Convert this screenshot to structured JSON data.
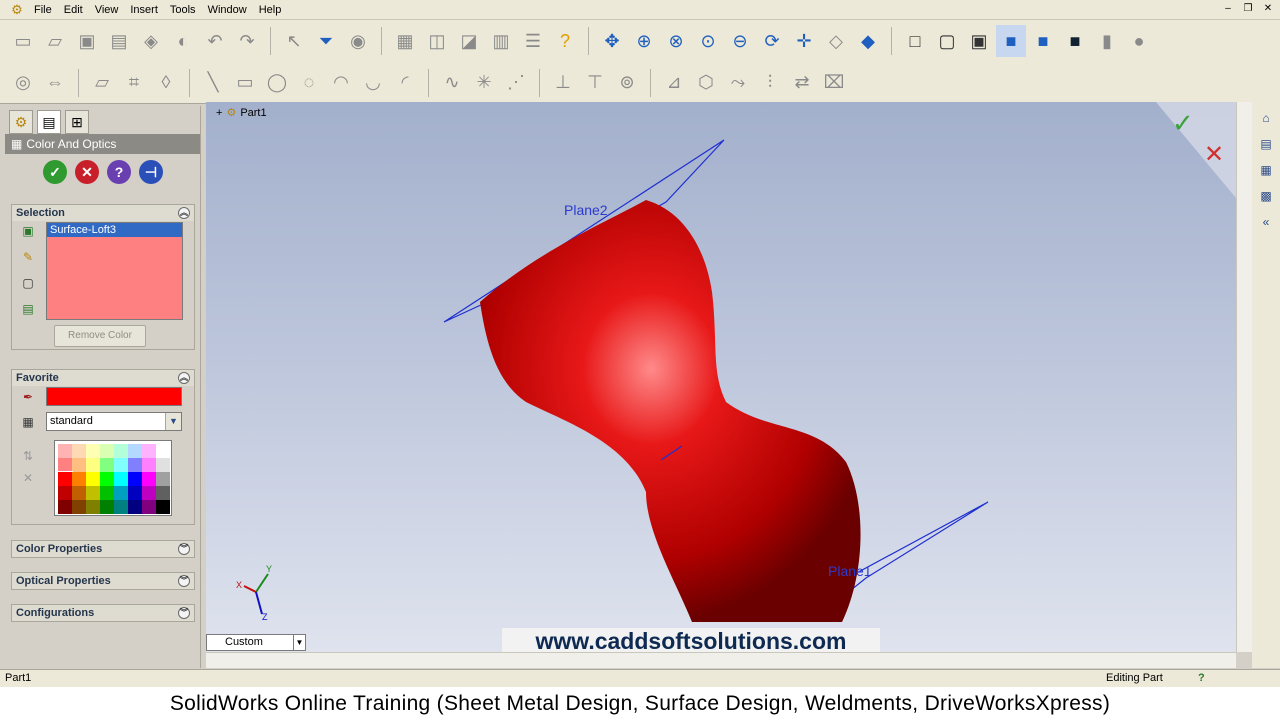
{
  "menubar": {
    "items": [
      "File",
      "Edit",
      "View",
      "Insert",
      "Tools",
      "Window",
      "Help"
    ]
  },
  "toolbar1": {
    "icons": [
      "new-icon",
      "open-icon",
      "save-icon",
      "print-icon",
      "rebuild-icon",
      "undo-icon",
      "redo-icon",
      "select-icon",
      "filter-icon",
      "help-icon",
      "zoom-to-fit-icon",
      "zoom-area-icon",
      "zoom-in-out-icon",
      "rotate-icon",
      "pan-icon",
      "view-orientation-icon",
      "wireframe-icon",
      "hidden-lines-icon",
      "shaded-edges-icon",
      "shaded-icon",
      "shadow-icon",
      "section-icon",
      "realview-icon"
    ]
  },
  "toolbar2": {
    "icons": [
      "sketch-icon",
      "smart-dimension-icon",
      "line-icon",
      "rectangle-icon",
      "circle-icon",
      "arc-icon",
      "spline-icon",
      "point-icon",
      "trim-icon",
      "mirror-icon",
      "offset-icon",
      "relations-icon",
      "repair-icon"
    ]
  },
  "panel": {
    "title": "Color And Optics",
    "selection": {
      "header": "Selection",
      "item": "Surface-Loft3",
      "remove_color": "Remove Color"
    },
    "favorite": {
      "header": "Favorite",
      "swatch_color": "#ff0000",
      "palette_value": "standard",
      "palette_colors": [
        "#ffb3b3",
        "#ffd9b3",
        "#ffffb3",
        "#d9ffb3",
        "#b3ffd9",
        "#b3d9ff",
        "#ffb3ff",
        "#ffffff",
        "#ff8080",
        "#ffbf80",
        "#ffff80",
        "#80ff80",
        "#80ffff",
        "#8080ff",
        "#ff80ff",
        "#e0e0e0",
        "#ff0000",
        "#ff8000",
        "#ffff00",
        "#00ff00",
        "#00ffff",
        "#0000ff",
        "#ff00ff",
        "#a0a0a0",
        "#c00000",
        "#c06000",
        "#c0c000",
        "#00c000",
        "#00a0c0",
        "#0000c0",
        "#c000c0",
        "#606060",
        "#800000",
        "#804000",
        "#808000",
        "#008000",
        "#008080",
        "#000080",
        "#800080",
        "#000000"
      ]
    },
    "color_properties": "Color Properties",
    "optical_properties": "Optical Properties",
    "configurations": "Configurations"
  },
  "viewport": {
    "tree_label": "Part1",
    "plane_top": "Plane2",
    "plane_bottom": "Plane1",
    "view_mode": "Custom",
    "watermark": "www.caddsoftsolutions.com",
    "axis_y": "Y",
    "axis_x": "X",
    "axis_z": "Z"
  },
  "status": {
    "left": "Part1",
    "right": "Editing Part"
  },
  "caption": "SolidWorks Online Training (Sheet Metal Design, Surface Design, Weldments, DriveWorksXpress)"
}
